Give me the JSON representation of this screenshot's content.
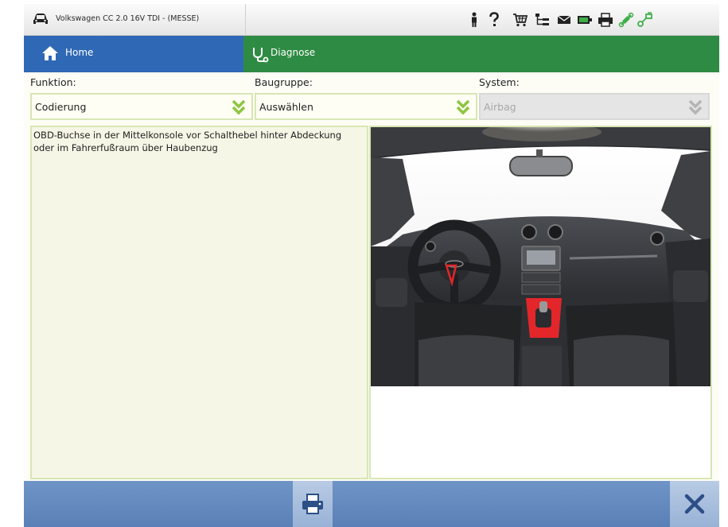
{
  "header": {
    "vehicle_title": "Volkswagen CC 2.0 16V TDI - (MESSE)",
    "icons": [
      "person-icon",
      "help-icon",
      "cart-icon",
      "network-icon",
      "mail-icon",
      "battery-icon",
      "printer-icon",
      "connection-icon",
      "link-icon"
    ]
  },
  "tabs": {
    "home_label": "Home",
    "diagnose_label": "Diagnose"
  },
  "filters": {
    "funktion": {
      "label": "Funktion:",
      "value": "Codierung"
    },
    "baugruppe": {
      "label": "Baugruppe:",
      "value": "Auswählen"
    },
    "system": {
      "label": "System:",
      "value": "Airbag",
      "disabled": true
    }
  },
  "description": "OBD-Buchse in der Mittelkonsole vor Schalthebel hinter Abdeckung oder im Fahrerfußraum über Haubenzug",
  "colors": {
    "home_tab": "#2f68b5",
    "diagnose_tab": "#2e8b43",
    "chevron": "#8cc63f",
    "bottom_bar": "#5a80b7",
    "highlight": "#e3262a"
  }
}
